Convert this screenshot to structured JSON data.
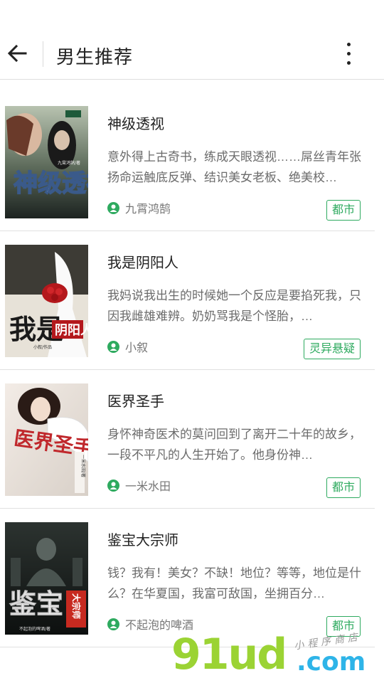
{
  "header": {
    "title": "男生推荐",
    "back_icon": "arrow-left-icon",
    "more_icon": "more-vertical-icon"
  },
  "books": [
    {
      "title": "神级透视",
      "description": "意外得上古奇书，练成天眼透视……屌丝青年张扬命运触底反弹、结识美女老板、绝美校…",
      "author": "九霄鸿鹄",
      "tag": "都市",
      "cover_text": "神级透视",
      "cover_author": "九霄鸿鹄/著"
    },
    {
      "title": "我是阴阳人",
      "description": "我妈说我出生的时候她一个反应是要掐死我，只因我雌雄难辨。奶奶骂我是个怪胎，…",
      "author": "小叙",
      "tag": "灵异悬疑",
      "cover_text": "我是",
      "cover_text2": "阴阳人",
      "cover_author": "小叙/作品"
    },
    {
      "title": "医界圣手",
      "description": "身怀神奇医术的莫问回到了离开二十年的故乡，一段不平凡的人生开始了。他身份神…",
      "author": "一米水田",
      "tag": "都市",
      "cover_text": "医界圣手",
      "cover_author": "一米水田/著"
    },
    {
      "title": "鉴宝大宗师",
      "description": "钱？我有！美女？不缺！地位？等等，地位是什么？在华夏国，我富可敌国，坐拥百分…",
      "author": "不起泡的啤酒",
      "tag": "都市",
      "cover_text": "鉴宝",
      "cover_text2": "大宗师",
      "cover_author": "不起泡的啤酒/著"
    }
  ],
  "watermark": {
    "main": "91ud",
    "domain": ".com",
    "small": "小程序商店"
  },
  "colors": {
    "accent": "#2eaa5f",
    "text_primary": "#222222",
    "text_secondary": "#6b6b6b"
  }
}
